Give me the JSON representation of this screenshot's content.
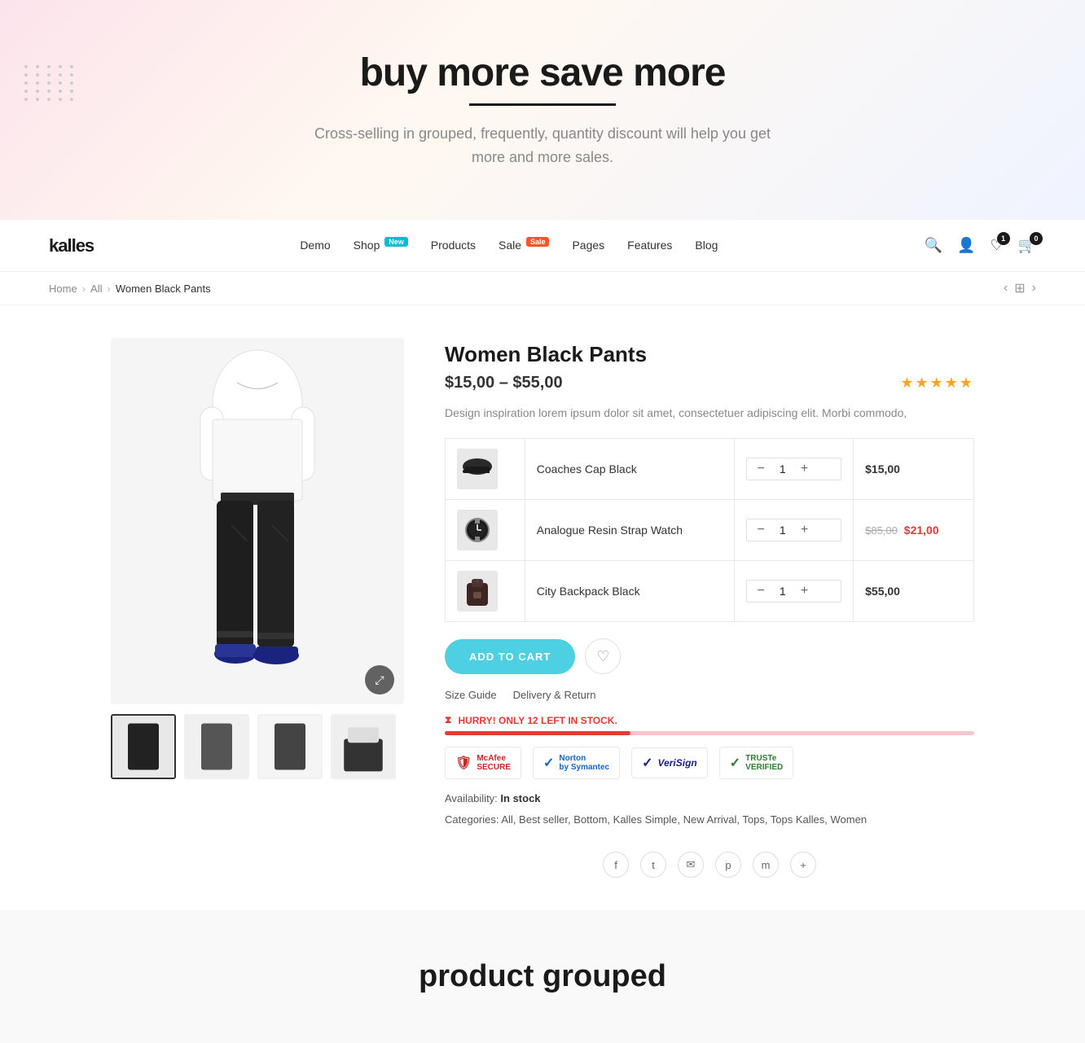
{
  "hero": {
    "title": "buy more save more",
    "subtitle": "Cross-selling in grouped, frequently,  quantity discount will help you get more and more sales."
  },
  "navbar": {
    "logo": "kalles",
    "menu": [
      {
        "label": "Demo",
        "badge": null
      },
      {
        "label": "Shop",
        "badge": "New"
      },
      {
        "label": "Products",
        "badge": null
      },
      {
        "label": "Sale",
        "badge": "Sale"
      },
      {
        "label": "Pages",
        "badge": null
      },
      {
        "label": "Features",
        "badge": null
      },
      {
        "label": "Blog",
        "badge": null
      }
    ],
    "wishlist_count": "1",
    "cart_count": "0"
  },
  "breadcrumb": {
    "home": "Home",
    "all": "All",
    "current": "Women Black Pants"
  },
  "product": {
    "title": "Women Black Pants",
    "price": "$15,00 – $55,00",
    "description": "Design inspiration lorem ipsum dolor sit amet, consectetuer adipiscing elit. Morbi commodo,",
    "stars": "★★★★★",
    "availability": "In stock",
    "categories": "All, Best seller, Bottom, Kalles Simple, New Arrival, Tops, Tops Kalles, Women",
    "grouped_items": [
      {
        "name": "Coaches Cap Black",
        "qty": 1,
        "price": "$15,00",
        "price_old": null,
        "price_new": null
      },
      {
        "name": "Analogue Resin Strap Watch",
        "qty": 1,
        "price": null,
        "price_old": "$85,00",
        "price_new": "$21,00"
      },
      {
        "name": "City Backpack Black",
        "qty": 1,
        "price": "$55,00",
        "price_old": null,
        "price_new": null
      }
    ],
    "add_to_cart_label": "ADD TO CART",
    "size_guide_label": "Size Guide",
    "delivery_return_label": "Delivery & Return",
    "stock_warning": "HURRY! ONLY 12 LEFT IN STOCK.",
    "stock_icon": "⧖"
  },
  "trust_badges": [
    {
      "name": "McAfee SECURE",
      "color": "tb-mcafee"
    },
    {
      "name": "Norton by Symantec",
      "color": "tb-norton"
    },
    {
      "name": "VeriSign",
      "color": "tb-verisign"
    },
    {
      "name": "TRUSTe verified",
      "color": "tb-truste"
    }
  ],
  "social": [
    "f",
    "t",
    "✉",
    "p",
    "m",
    "+"
  ],
  "bottom": {
    "title": "product grouped"
  }
}
